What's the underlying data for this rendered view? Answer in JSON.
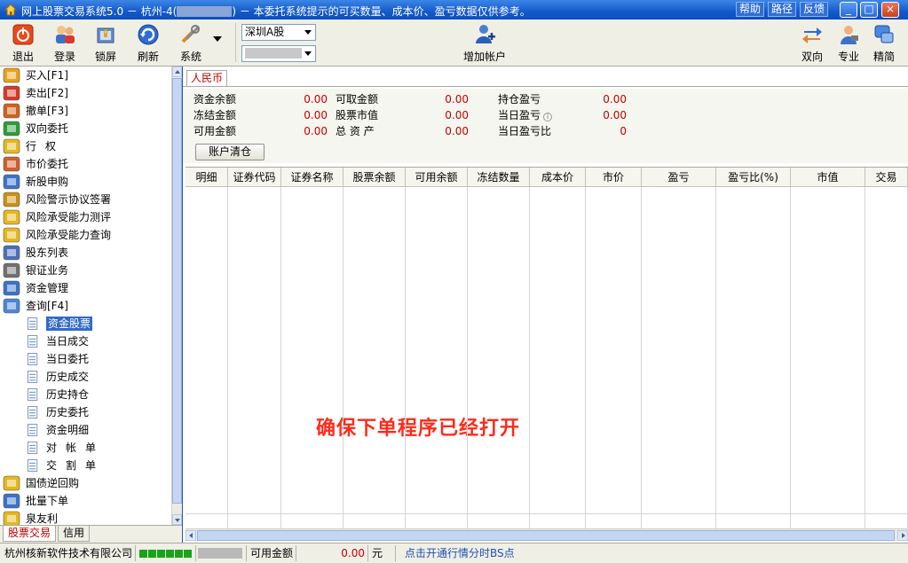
{
  "window": {
    "title_prefix": "网上股票交易系统5.0 － 杭州-4(",
    "title_suffix": ") － 本委托系统提示的可买数量、成本价、盈亏数据仅供参考。",
    "links": [
      "帮助",
      "路径",
      "反馈"
    ],
    "controls": {
      "minimize": "_",
      "maximize": "□",
      "close": "×"
    }
  },
  "toolbar": {
    "exit": "退出",
    "login": "登录",
    "lock": "锁屏",
    "refresh": "刷新",
    "system": "系统",
    "market_select": "深圳A股",
    "add_account": "增加帐户",
    "bidirectional": "双向",
    "professional": "专业",
    "compact": "精简"
  },
  "nav": {
    "items": [
      {
        "label": "买入[F1]",
        "icon": "buy-icon"
      },
      {
        "label": "卖出[F2]",
        "icon": "sell-icon"
      },
      {
        "label": "撤单[F3]",
        "icon": "cancel-hand-icon"
      },
      {
        "label": "双向委托",
        "icon": "bidirectional-order-icon"
      },
      {
        "label": "行权",
        "icon": "exercise-icon"
      },
      {
        "label": "市价委托",
        "icon": "market-order-icon"
      },
      {
        "label": "新股申购",
        "icon": "ipo-icon"
      },
      {
        "label": "风险警示协议签署",
        "icon": "sign-icon"
      },
      {
        "label": "风险承受能力测评",
        "icon": "risk-eval-icon"
      },
      {
        "label": "风险承受能力查询",
        "icon": "risk-query-icon"
      },
      {
        "label": "股东列表",
        "icon": "shareholder-list-icon"
      },
      {
        "label": "银证业务",
        "icon": "bank-transfer-icon"
      },
      {
        "label": "资金管理",
        "icon": "fund-management-icon"
      },
      {
        "label": "查询[F4]",
        "icon": "query-icon"
      }
    ],
    "subitems": [
      "资金股票",
      "当日成交",
      "当日委托",
      "历史成交",
      "历史持仓",
      "历史委托",
      "资金明细",
      "对帐单",
      "交割单"
    ],
    "items_after": [
      {
        "label": "国债逆回购",
        "icon": "repo-icon"
      },
      {
        "label": "批量下单",
        "icon": "batch-order-icon"
      },
      {
        "label": "泉友利",
        "icon": "quanyouli-icon"
      }
    ],
    "tabs": [
      "股票交易",
      "信用"
    ]
  },
  "content": {
    "currency_tab": "人民币",
    "summary": {
      "cash_balance_label": "资金余额",
      "cash_balance": "0.00",
      "frozen_label": "冻结金额",
      "frozen": "0.00",
      "available_label": "可用金额",
      "available": "0.00",
      "withdrawable_label": "可取金额",
      "withdrawable": "0.00",
      "stock_value_label": "股票市值",
      "stock_value": "0.00",
      "total_assets_label": "总 资 产",
      "total_assets": "0.00",
      "position_pl_label": "持仓盈亏",
      "position_pl": "0.00",
      "today_pl_label": "当日盈亏",
      "today_pl": "0.00",
      "today_pl_ratio_label": "当日盈亏比",
      "today_pl_ratio": "0"
    },
    "clear_button": "账户清仓",
    "table_headers": [
      "明细",
      "证券代码",
      "证券名称",
      "股票余额",
      "可用余额",
      "冻结数量",
      "成本价",
      "市价",
      "盈亏",
      "盈亏比(%)",
      "市值",
      "交易"
    ],
    "overlay_notice": "确保下单程序已经打开"
  },
  "status": {
    "company": "杭州核新软件技术有限公司",
    "available_label": "可用金额",
    "available_value": "0.00",
    "unit": "元",
    "hint": "点击开通行情分时BS点"
  },
  "colors": {
    "titlebar": "#1459c9",
    "accent_red": "#c00000",
    "selection": "#316ac5"
  }
}
